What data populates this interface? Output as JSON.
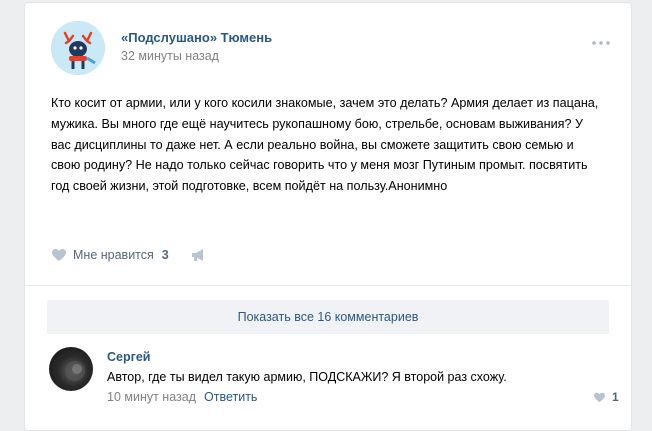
{
  "post": {
    "group_name": "«Подслушано» Тюмень",
    "time": "32 минуты назад",
    "more_icon": "more-icon",
    "text": "Кто косит от армии, или у кого косили знакомые, зачем это делать? Армия делает из пацана, мужика. Вы много где ещё научитесь рукопашному бою, стрельбе, основам выживания? У вас дисциплины то даже нет. А если реально война, вы сможете защитить свою семью и свою родину? Не надо только сейчас говорить что у меня мозг Путиным промыт. посвятить год своей жизни, этой подготовке, всем пойдёт на пользу.Анонимно",
    "like_label": "Мне нравится",
    "like_count": "3"
  },
  "comments": {
    "show_all_label": "Показать все 16 комментариев",
    "items": [
      {
        "author": "Сергей",
        "text": "Автор, где ты видел такую армию, ПОДСКАЖИ? Я второй раз схожу.",
        "time": "10 минут назад",
        "reply_label": "Ответить",
        "like_count": "1"
      }
    ]
  },
  "colors": {
    "link": "#2a5885",
    "meta": "#828282",
    "action": "#55677d",
    "background": "#edeef0"
  }
}
